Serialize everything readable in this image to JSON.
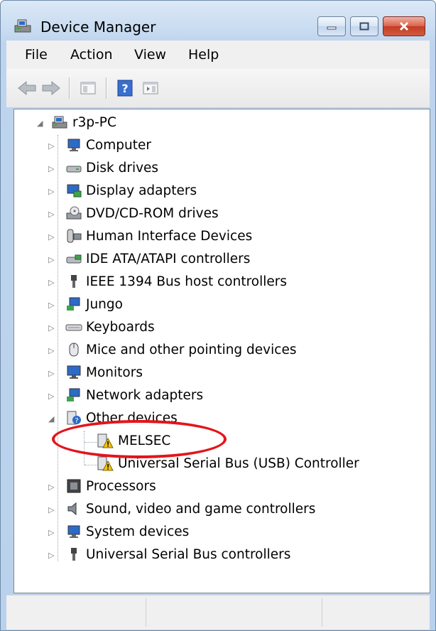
{
  "window": {
    "title": "Device Manager"
  },
  "menu": {
    "file": "File",
    "action": "Action",
    "view": "View",
    "help": "Help"
  },
  "tree": {
    "root": "r3p-PC",
    "categories": [
      "Computer",
      "Disk drives",
      "Display adapters",
      "DVD/CD-ROM drives",
      "Human Interface Devices",
      "IDE ATA/ATAPI controllers",
      "IEEE 1394 Bus host controllers",
      "Jungo",
      "Keyboards",
      "Mice and other pointing devices",
      "Monitors",
      "Network adapters",
      "Other devices",
      "Processors",
      "Sound, video and game controllers",
      "System devices",
      "Universal Serial Bus controllers"
    ],
    "other_devices": [
      "MELSEC",
      "Universal Serial Bus (USB) Controller"
    ]
  },
  "colors": {
    "highlight": "#e4141b",
    "window_frame": "#bed4ee",
    "warning": "#f5c400"
  }
}
